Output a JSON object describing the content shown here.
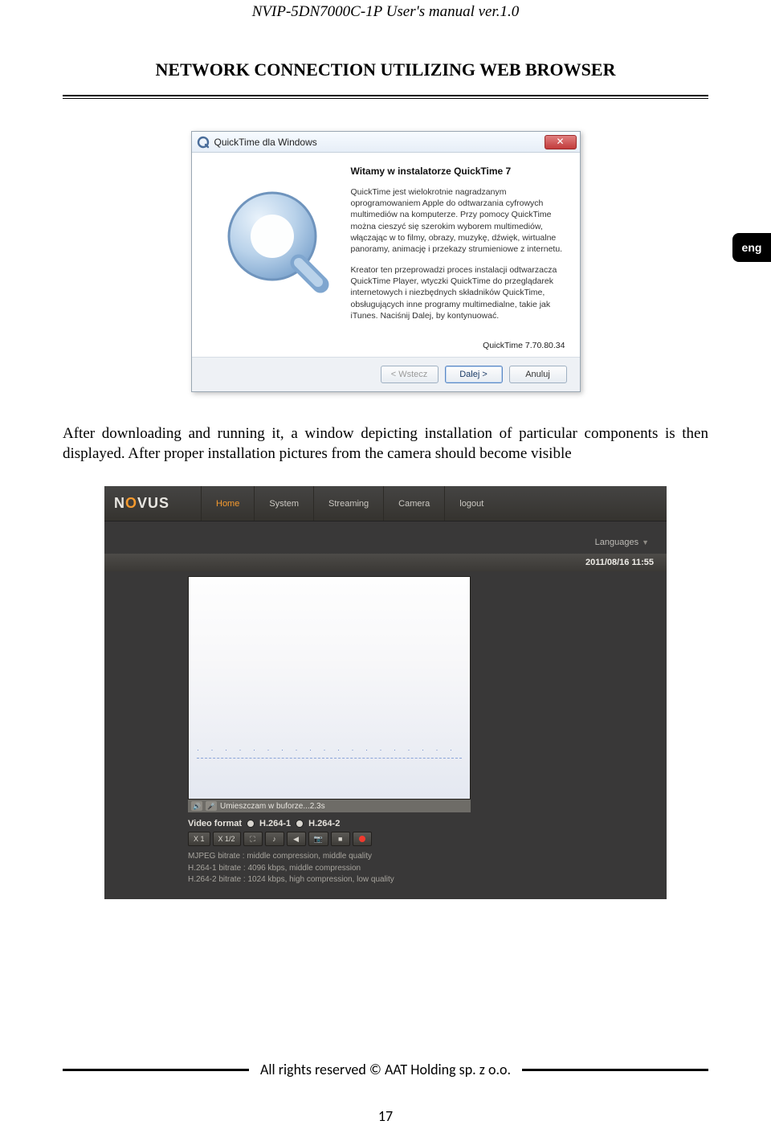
{
  "doc": {
    "header": "NVIP-5DN7000C-1P User's manual ver.1.0",
    "section_title": "NETWORK CONNECTION UTILIZING WEB BROWSER",
    "lang_tab": "eng",
    "paragraph": "After downloading and running it, a window depicting installation of particular components is then displayed. After proper installation pictures from the camera should become visible",
    "footer": "All rights reserved © AAT Holding sp. z o.o.",
    "page_no": "17"
  },
  "qt": {
    "title": "QuickTime dla Windows",
    "welcome": "Witamy w instalatorze QuickTime 7",
    "p1": "QuickTime jest wielokrotnie nagradzanym oprogramowaniem Apple do odtwarzania cyfrowych multimediów na komputerze. Przy pomocy QuickTime można cieszyć się szerokim wyborem multimediów, włączając w to filmy, obrazy, muzykę, dźwięk, wirtualne panoramy, animację i przekazy strumieniowe z internetu.",
    "p2": "Kreator ten przeprowadzi proces instalacji odtwarzacza QuickTime Player, wtyczki QuickTime do przeglądarek internetowych i niezbędnych składników QuickTime, obsługujących inne programy multimedialne, takie jak iTunes. Naciśnij Dalej, by kontynuować.",
    "version": "QuickTime 7.70.80.34",
    "btn_back": "< Wstecz",
    "btn_next": "Dalej >",
    "btn_cancel": "Anuluj",
    "close": "✕"
  },
  "novus": {
    "logo_a": "N",
    "logo_b": "O",
    "logo_c": "VUS",
    "nav": {
      "home": "Home",
      "system": "System",
      "streaming": "Streaming",
      "camera": "Camera",
      "logout": "logout"
    },
    "languages": "Languages",
    "timestamp": "2011/08/16 11:55",
    "status": "Umieszczam w buforze...2.3s",
    "vf_label": "Video format",
    "vf_opt1": "H.264-1",
    "vf_opt2": "H.264-2",
    "btn_x1": "X 1",
    "btn_x12": "X 1/2",
    "info1": "MJPEG bitrate : middle compression, middle quality",
    "info2": "H.264-1 bitrate : 4096 kbps, middle compression",
    "info3": "H.264-2 bitrate : 1024 kbps, high compression, low quality"
  }
}
